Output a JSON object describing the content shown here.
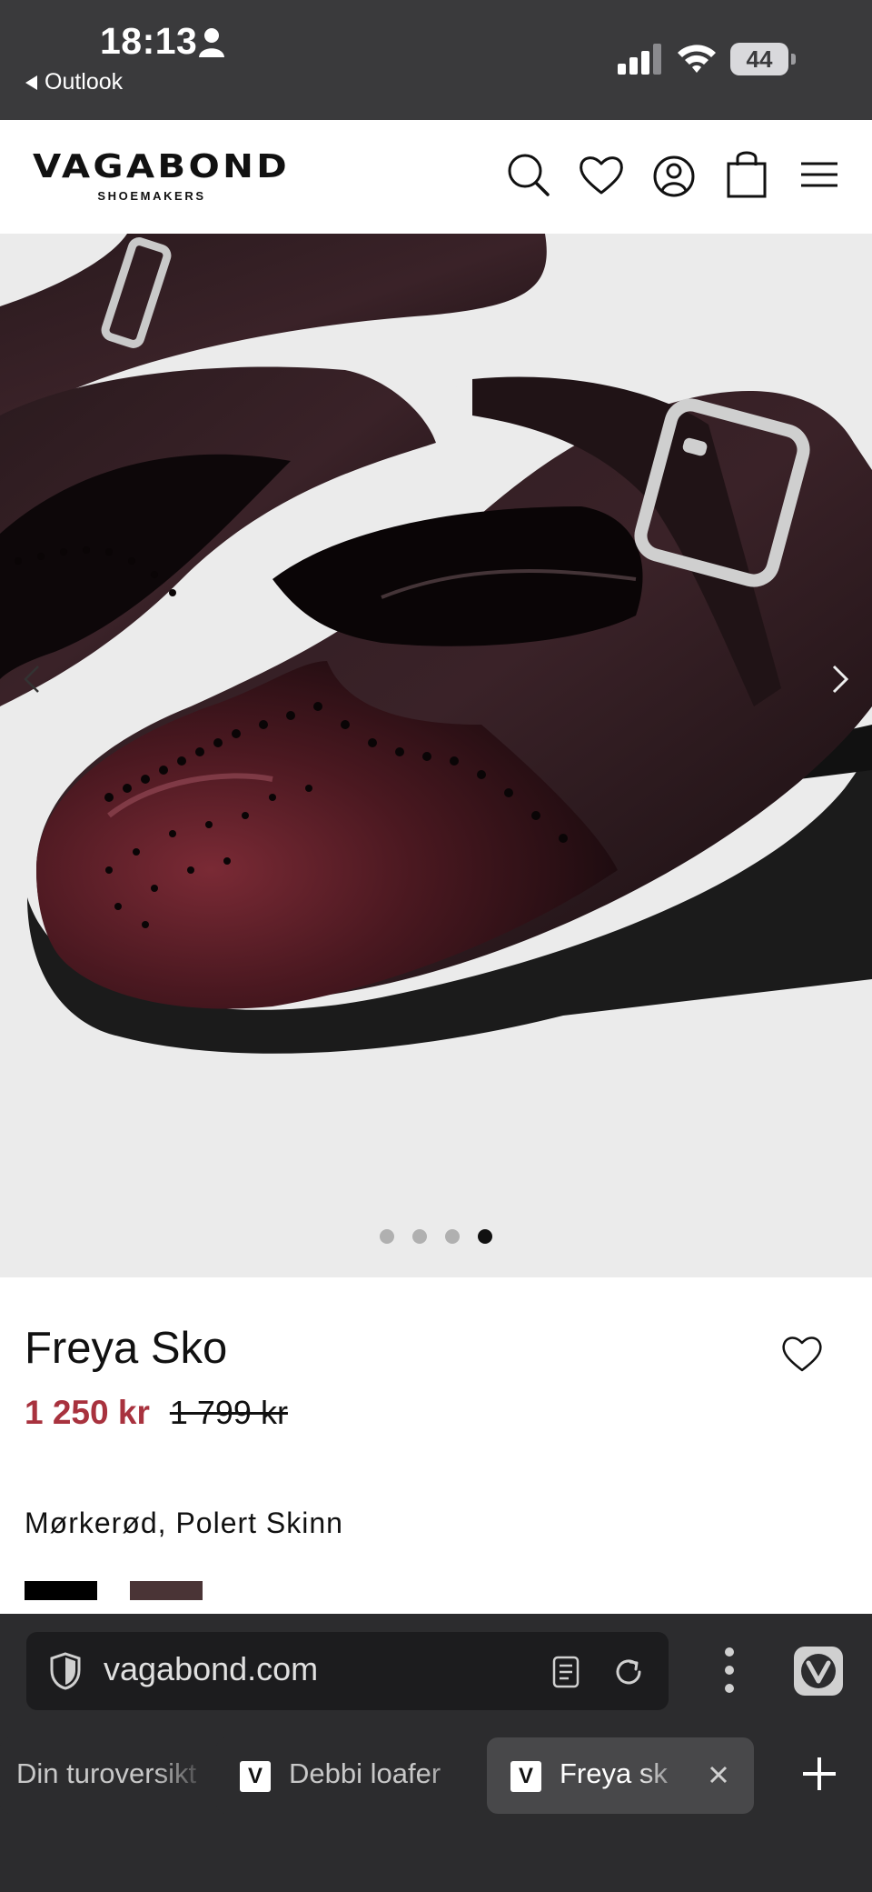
{
  "status_bar": {
    "time": "18:13",
    "back_app": "Outlook",
    "battery": "44"
  },
  "site": {
    "logo_main": "VAGABOND",
    "logo_sub": "SHOEMAKERS"
  },
  "gallery": {
    "image_count": 4,
    "active_index": 3
  },
  "product": {
    "title": "Freya Sko",
    "sale_price": "1 250 kr",
    "original_price": "1 799 kr",
    "color_name": "Mørkerød, Polert Skinn",
    "swatches": [
      "#000000",
      "#4a3436"
    ],
    "sale_color": "#a8323e"
  },
  "browser": {
    "url": "vagabond.com"
  },
  "tabs": [
    {
      "label": "Din turoversikt",
      "favicon": ""
    },
    {
      "label": "Debbi loafer",
      "favicon": "V"
    },
    {
      "label": "Freya sko",
      "favicon": "V"
    }
  ]
}
